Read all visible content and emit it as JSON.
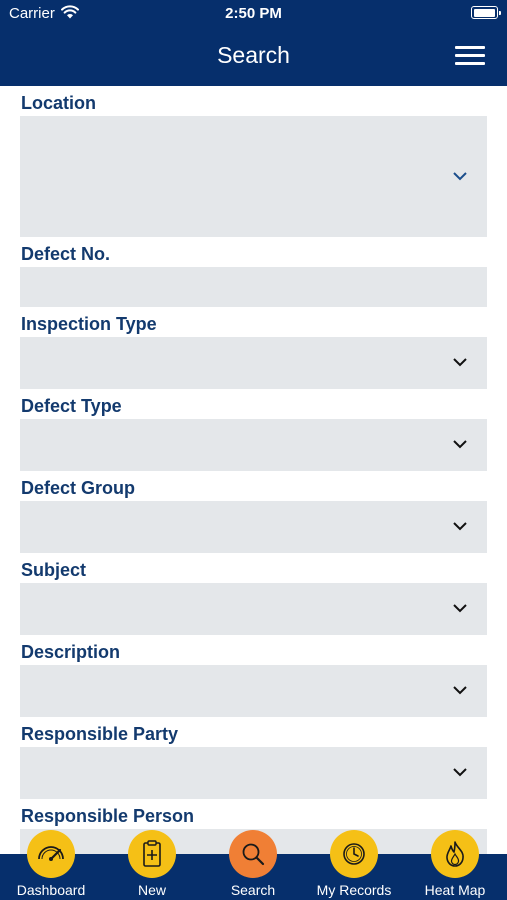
{
  "status_bar": {
    "carrier": "Carrier",
    "time": "2:50 PM",
    "battery_level": 1.0
  },
  "header": {
    "title": "Search",
    "menu_icon": "hamburger-menu-icon"
  },
  "form": {
    "fields": [
      {
        "label": "Location",
        "type": "select",
        "value": ""
      },
      {
        "label": "Defect No.",
        "type": "text",
        "value": ""
      },
      {
        "label": "Inspection Type",
        "type": "select",
        "value": ""
      },
      {
        "label": "Defect Type",
        "type": "select",
        "value": ""
      },
      {
        "label": "Defect Group",
        "type": "select",
        "value": ""
      },
      {
        "label": "Subject",
        "type": "select",
        "value": ""
      },
      {
        "label": "Description",
        "type": "select",
        "value": ""
      },
      {
        "label": "Responsible Party",
        "type": "select",
        "value": ""
      },
      {
        "label": "Responsible Person",
        "type": "select",
        "value": ""
      }
    ]
  },
  "tab_bar": {
    "tabs": [
      {
        "label": "Dashboard",
        "icon": "gauge-icon",
        "active": false
      },
      {
        "label": "New",
        "icon": "new-clipboard-icon",
        "active": false
      },
      {
        "label": "Search",
        "icon": "search-icon",
        "active": true
      },
      {
        "label": "My Records",
        "icon": "clock-icon",
        "active": false
      },
      {
        "label": "Heat Map",
        "icon": "flame-icon",
        "active": false
      }
    ]
  },
  "colors": {
    "nav_blue": "#062f6c",
    "label_blue": "#133a6e",
    "field_bg": "#e4e7ea",
    "tab_yellow": "#f5c016",
    "tab_active": "#f07f35"
  }
}
